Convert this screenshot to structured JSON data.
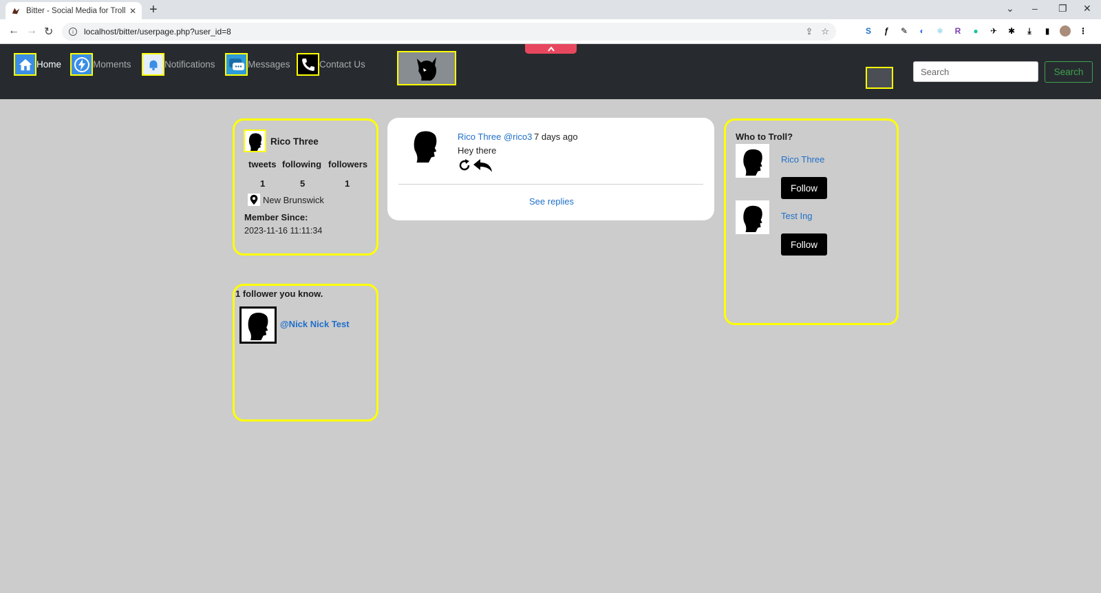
{
  "browser": {
    "tab_title": "Bitter - Social Media for Trolls, N",
    "url": "localhost/bitter/userpage.php?user_id=8"
  },
  "nav": {
    "items": [
      {
        "label": "Home"
      },
      {
        "label": "Moments"
      },
      {
        "label": "Notifications"
      },
      {
        "label": "Messages"
      },
      {
        "label": "Contact Us"
      }
    ],
    "search_placeholder": "Search",
    "search_button": "Search"
  },
  "profile": {
    "name": "Rico Three",
    "stat_labels": [
      "tweets",
      "following",
      "followers"
    ],
    "stat_values": [
      "1",
      "5",
      "1"
    ],
    "location": "New Brunswick",
    "member_since_label": "Member Since:",
    "member_since": "2023-11-16 11:11:34"
  },
  "mutual": {
    "title": "1 follower you know.",
    "follower": "@Nick Nick Test"
  },
  "tweet": {
    "author": "Rico Three @rico3",
    "time": "7 days ago",
    "text": "Hey there",
    "see_replies": "See replies"
  },
  "who_to_troll": {
    "title": "Who to Troll?",
    "users": [
      {
        "name": "Rico Three",
        "button": "Follow"
      },
      {
        "name": "Test Ing",
        "button": "Follow"
      }
    ]
  },
  "colors": {
    "navbar": "#272b30",
    "highlight": "#ffff00",
    "link": "#1f6fc9",
    "search_green": "#3fa34d",
    "page_bg": "#cccccc"
  }
}
